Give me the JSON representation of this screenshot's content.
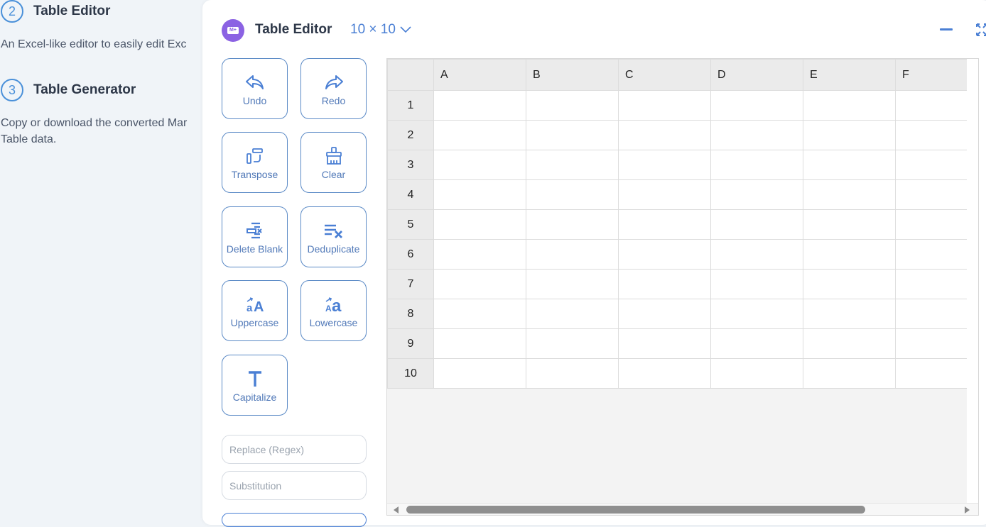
{
  "steps": [
    {
      "number": "2",
      "title": "Table Editor",
      "description": [
        "An Excel-like editor to easily edit Exc"
      ]
    },
    {
      "number": "3",
      "title": "Table Generator",
      "description": [
        "Copy or download the converted Mar",
        "Table data."
      ]
    }
  ],
  "editor": {
    "logo": "M+",
    "title": "Table Editor",
    "size_label": "10 × 10",
    "icons": {
      "minimize": "minimize-icon",
      "fullscreen": "fullscreen-icon",
      "size_dropdown": "chevron-down-icon"
    }
  },
  "tools": [
    {
      "label": "Undo",
      "icon": "undo-icon"
    },
    {
      "label": "Redo",
      "icon": "redo-icon"
    },
    {
      "label": "Transpose",
      "icon": "transpose-icon"
    },
    {
      "label": "Clear",
      "icon": "broom-icon"
    },
    {
      "label": "Delete Blank",
      "icon": "delete-blank-icon"
    },
    {
      "label": "Deduplicate",
      "icon": "deduplicate-icon"
    },
    {
      "label": "Uppercase",
      "icon": "uppercase-icon"
    },
    {
      "label": "Lowercase",
      "icon": "lowercase-icon"
    },
    {
      "label": "Capitalize",
      "icon": "capitalize-icon"
    }
  ],
  "inputs": {
    "replace_placeholder": "Replace (Regex)",
    "replace_value": "",
    "substitution_placeholder": "Substitution",
    "substitution_value": ""
  },
  "grid": {
    "columns": [
      "A",
      "B",
      "C",
      "D",
      "E",
      "F"
    ],
    "rows": [
      "1",
      "2",
      "3",
      "4",
      "5",
      "6",
      "7",
      "8",
      "9",
      "10"
    ]
  },
  "colors": {
    "accent": "#4a7fd4",
    "logo": "#8b62e3"
  }
}
